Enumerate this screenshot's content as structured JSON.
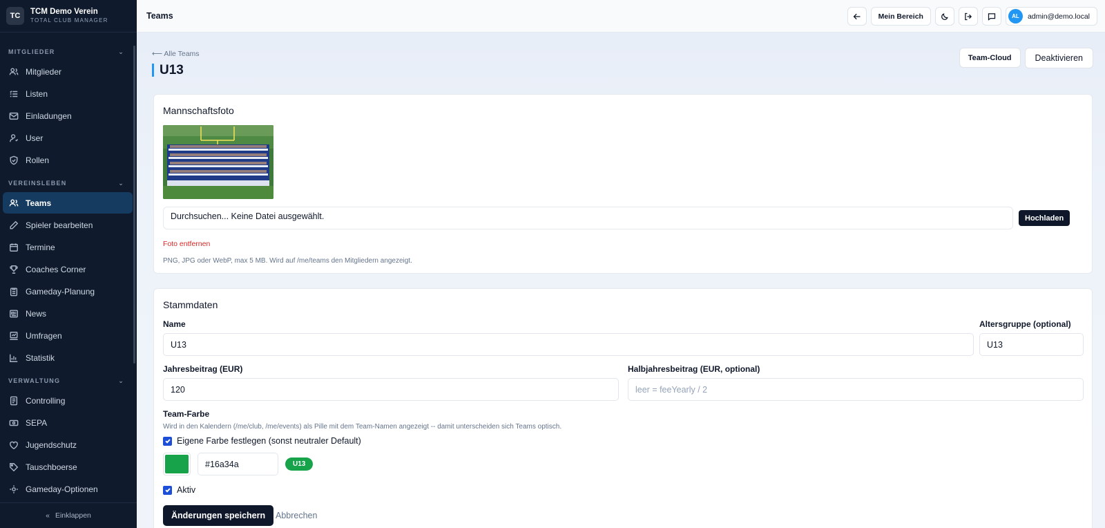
{
  "brand": {
    "logo": "TC",
    "name": "TCM Demo Verein",
    "sub": "TOTAL CLUB MANAGER"
  },
  "sidebar": {
    "sections": [
      {
        "title": "MITGLIEDER",
        "items": [
          {
            "label": "Mitglieder",
            "icon": "users-icon"
          },
          {
            "label": "Listen",
            "icon": "list-icon"
          },
          {
            "label": "Einladungen",
            "icon": "mail-icon"
          },
          {
            "label": "User",
            "icon": "user-icon"
          },
          {
            "label": "Rollen",
            "icon": "shield-icon"
          }
        ]
      },
      {
        "title": "VEREINSLEBEN",
        "items": [
          {
            "label": "Teams",
            "icon": "team-icon",
            "active": true
          },
          {
            "label": "Spieler bearbeiten",
            "icon": "pencil-icon"
          },
          {
            "label": "Termine",
            "icon": "calendar-icon"
          },
          {
            "label": "Coaches Corner",
            "icon": "trophy-icon"
          },
          {
            "label": "Gameday-Planung",
            "icon": "clipboard-icon"
          },
          {
            "label": "News",
            "icon": "newspaper-icon"
          },
          {
            "label": "Umfragen",
            "icon": "poll-icon"
          },
          {
            "label": "Statistik",
            "icon": "chart-icon"
          }
        ]
      },
      {
        "title": "VERWALTUNG",
        "items": [
          {
            "label": "Controlling",
            "icon": "document-icon"
          },
          {
            "label": "SEPA",
            "icon": "bank-icon"
          },
          {
            "label": "Jugendschutz",
            "icon": "heart-shield-icon"
          },
          {
            "label": "Tauschboerse",
            "icon": "tag-icon"
          },
          {
            "label": "Gameday-Optionen",
            "icon": "settings-icon"
          }
        ]
      }
    ],
    "collapse_label": "Einklappen"
  },
  "topbar": {
    "title": "Teams",
    "my_area": "Mein Bereich",
    "user_initials": "AL",
    "user_email": "admin@demo.local"
  },
  "page": {
    "back": "⟵ Alle Teams",
    "title": "U13",
    "team_cloud": "Team-Cloud",
    "deactivate": "Deaktivieren"
  },
  "photo_card": {
    "title": "Mannschaftsfoto",
    "file_text": "Durchsuchen... Keine Datei ausgewählt.",
    "upload": "Hochladen",
    "remove": "Foto entfernen",
    "hint": "PNG, JPG oder WebP, max 5 MB. Wird auf /me/teams den Mitgliedern angezeigt."
  },
  "master_card": {
    "title": "Stammdaten",
    "name_label": "Name",
    "name_value": "U13",
    "age_label": "Altersgruppe (optional)",
    "age_value": "U13",
    "fee_label": "Jahresbeitrag (EUR)",
    "fee_value": "120",
    "half_label": "Halbjahresbeitrag (EUR, optional)",
    "half_placeholder": "leer = feeYearly / 2",
    "color_label": "Team-Farbe",
    "color_desc": "Wird in den Kalendern (/me/club, /me/events) als Pille mit dem Team-Namen angezeigt -- damit unterscheiden sich Teams optisch.",
    "own_color_label": "Eigene Farbe festlegen (sonst neutraler Default)",
    "color_value": "#16a34a",
    "pill_text": "U13",
    "active_label": "Aktiv",
    "save": "Änderungen speichern",
    "cancel": "Abbrechen"
  },
  "colors": {
    "accent": "#2196f3",
    "team_color": "#16a34a",
    "danger": "#dc2626",
    "sidebar_bg": "#0f1b2d"
  }
}
